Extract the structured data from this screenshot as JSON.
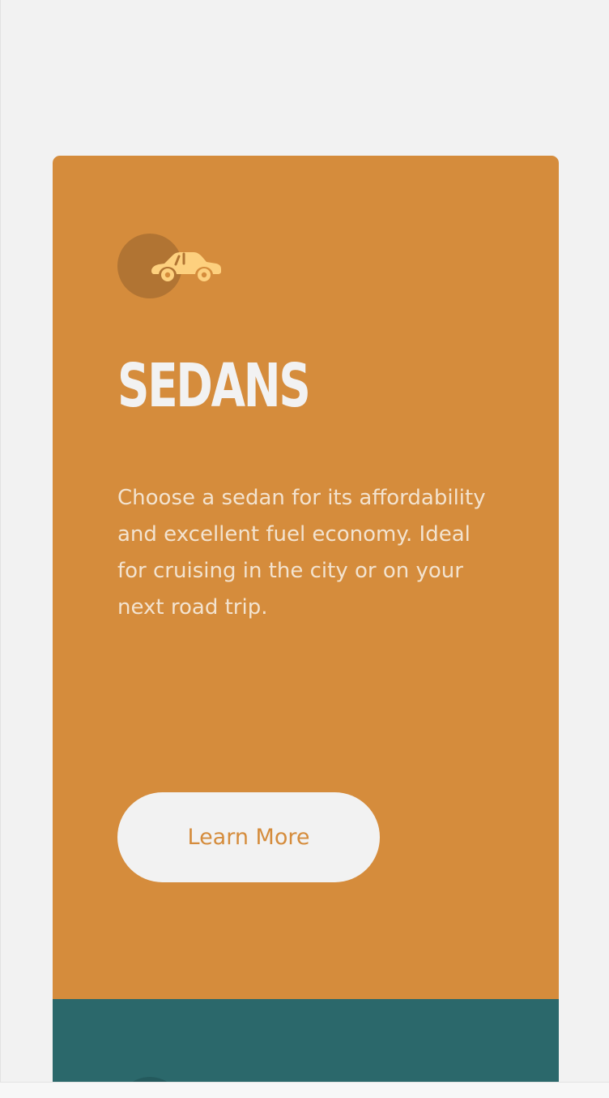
{
  "colors": {
    "page_background": "#f2f2f2",
    "sedans_card": "#d58c3c",
    "suvs_card": "#2b686b",
    "sedans_icon_circle": "#b17433",
    "sedans_icon_car": "#fdd07e",
    "suvs_icon_circle": "#245a5d",
    "title_text": "#f2f2f2",
    "description_text": "#f3e3cf",
    "button_background": "#f2f2f2",
    "button_text": "#d58c3c"
  },
  "cards": [
    {
      "id": "sedans",
      "icon": "sedan-car-icon",
      "title": "SEDANS",
      "description": "Choose a sedan for its affordability and excellent fuel economy. Ideal for cruising in the city or on your next road trip.",
      "button_label": "Learn More"
    },
    {
      "id": "suvs",
      "icon": "suv-car-icon"
    }
  ]
}
